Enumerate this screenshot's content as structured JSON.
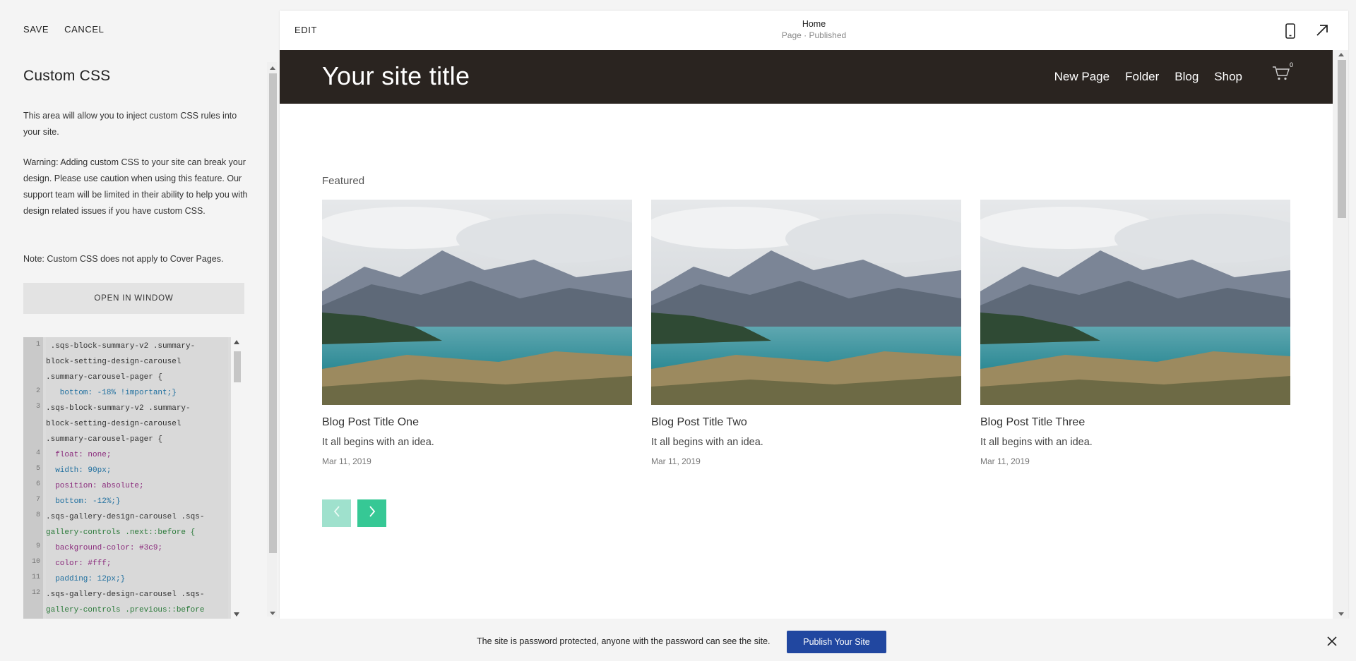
{
  "panel": {
    "save_label": "SAVE",
    "cancel_label": "CANCEL",
    "title": "Custom CSS",
    "intro": "This area will allow you to inject custom CSS rules into your site.",
    "warning": "Warning: Adding custom CSS to your site can break your design. Please use caution when using this feature. Our support team will be limited in their ability to help you with design related issues if you have custom CSS.",
    "note": "Note: Custom CSS does not apply to Cover Pages.",
    "open_window_label": "OPEN IN WINDOW"
  },
  "code_editor": {
    "line_numbers": [
      "1",
      "2",
      "3",
      "4",
      "5",
      "6",
      "7",
      "8",
      "9",
      "10",
      "11",
      "12"
    ],
    "lines": [
      " .sqs-block-summary-v2 .summary-",
      "block-setting-design-carousel",
      ".summary-carousel-pager {",
      "   bottom: -18% !important;}",
      ".sqs-block-summary-v2 .summary-",
      "block-setting-design-carousel",
      ".summary-carousel-pager {",
      "  float: none;",
      "  width: 90px;",
      "  position: absolute;",
      "  bottom: -12%;}",
      ".sqs-gallery-design-carousel .sqs-",
      "gallery-controls .next::before {",
      "  background-color: #3c9;",
      "  color: #fff;",
      "  padding: 12px;}",
      ".sqs-gallery-design-carousel .sqs-",
      "gallery-controls .previous::before"
    ]
  },
  "preview": {
    "edit_label": "EDIT",
    "page_name": "Home",
    "page_status": "Page · Published",
    "icons": [
      "mobile-icon",
      "open-external-icon"
    ]
  },
  "site": {
    "title": "Your site title",
    "nav": [
      "New Page",
      "Folder",
      "Blog",
      "Shop"
    ],
    "cart_count": "0",
    "header_color": "#2a2420"
  },
  "featured": {
    "label": "Featured",
    "posts": [
      {
        "title": "Blog Post Title One",
        "excerpt": "It all begins with an idea.",
        "date": "Mar 11, 2019"
      },
      {
        "title": "Blog Post Title Two",
        "excerpt": "It all begins with an idea.",
        "date": "Mar 11, 2019"
      },
      {
        "title": "Blog Post Title Three",
        "excerpt": "It all begins with an idea.",
        "date": "Mar 11, 2019"
      }
    ],
    "arrow_color": "#36c895",
    "arrow_disabled_color": "#9fe1cd"
  },
  "bottom_bar": {
    "message": "The site is password protected, anyone with the password can see the site.",
    "publish_label": "Publish Your Site",
    "publish_color": "#2147a0"
  }
}
